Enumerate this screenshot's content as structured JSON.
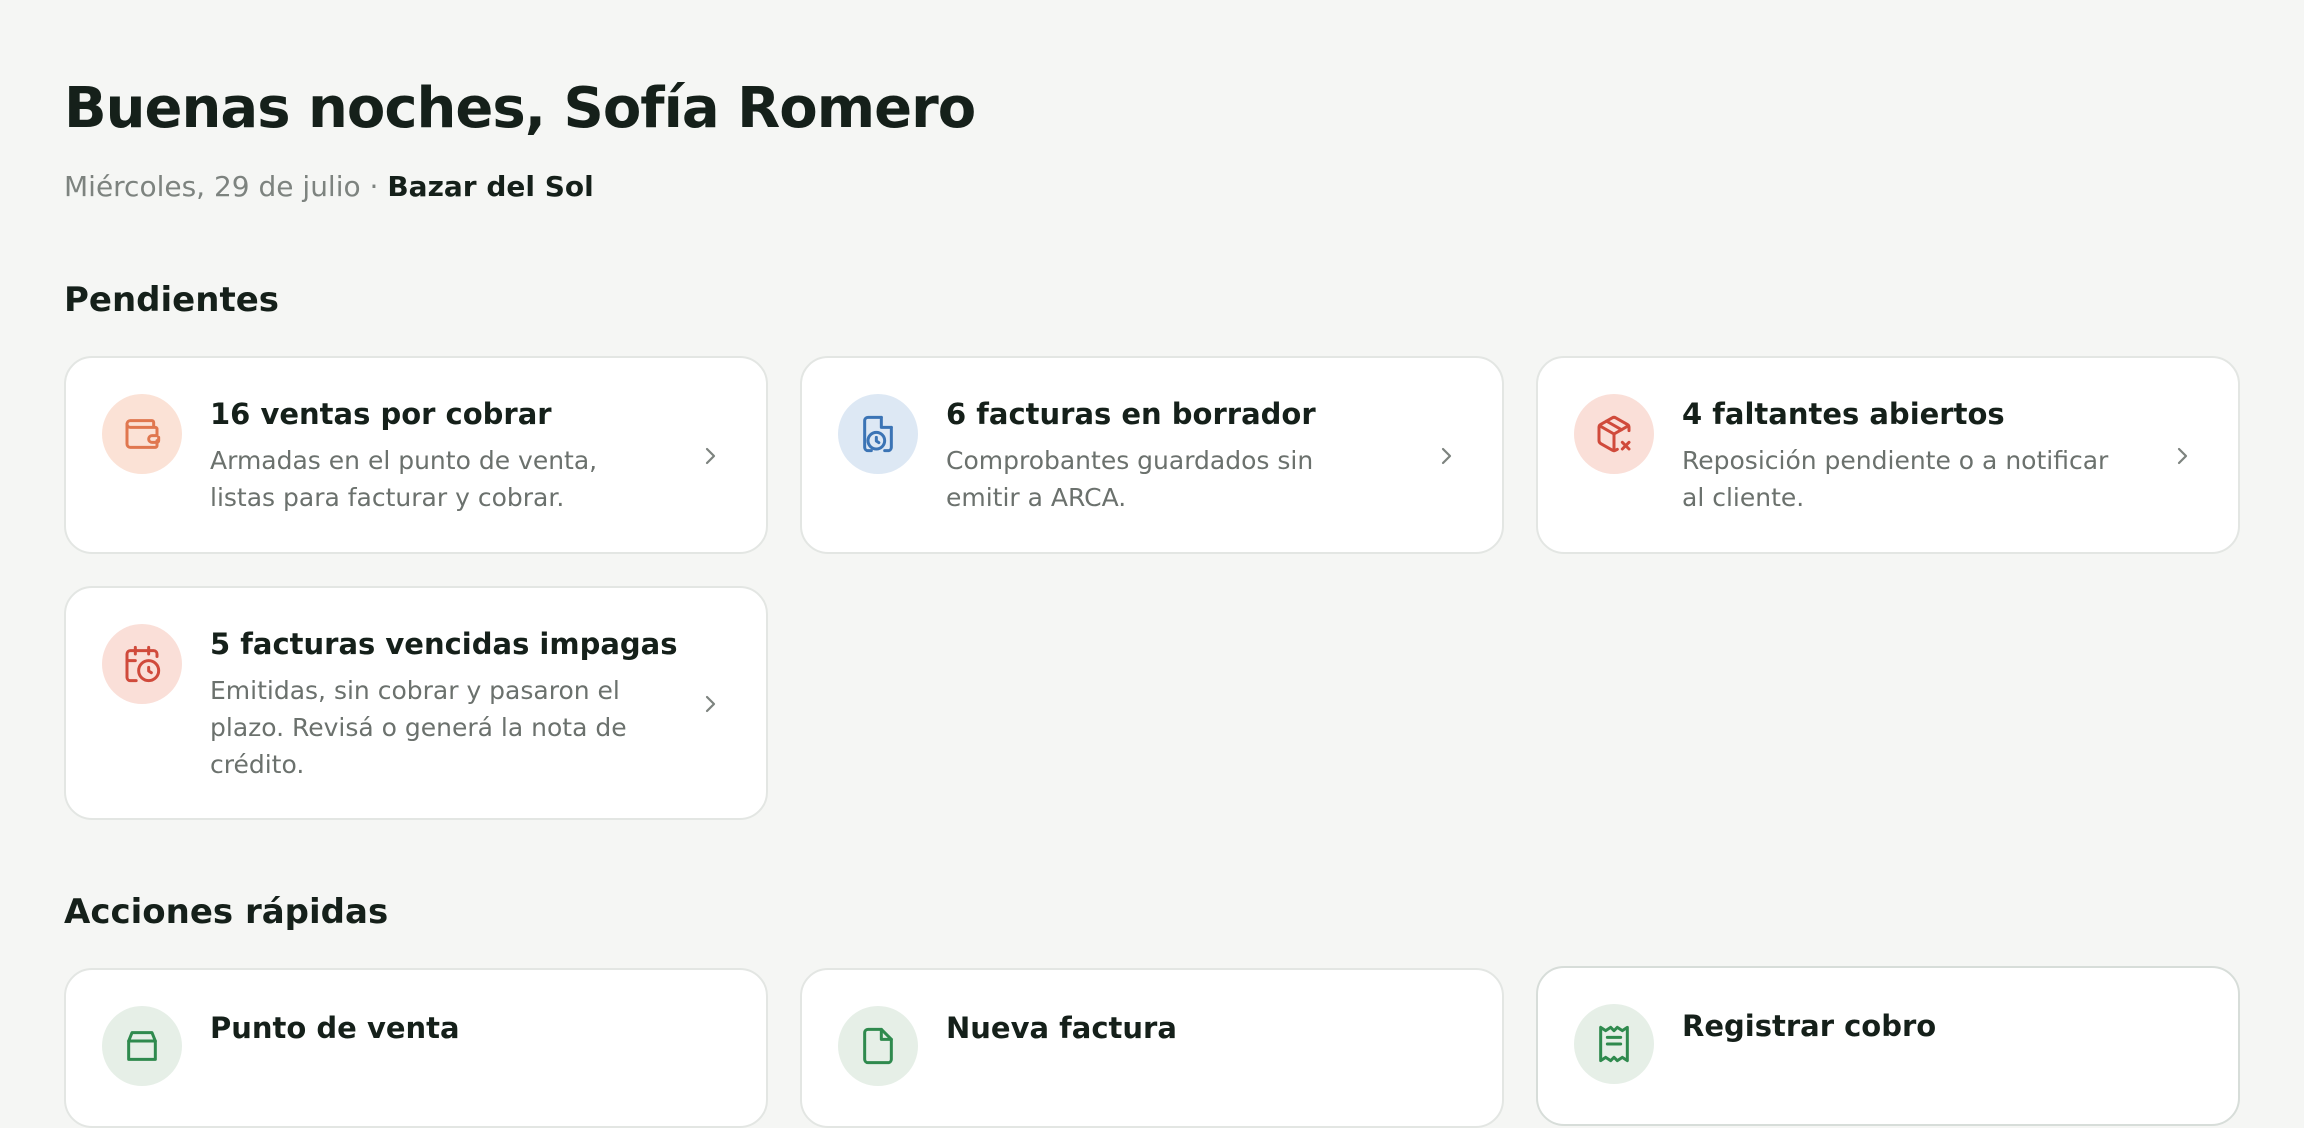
{
  "header": {
    "greeting": "Buenas noches, Sofía Romero",
    "date": "Miércoles, 29 de julio",
    "separator": " · ",
    "store": "Bazar del Sol"
  },
  "pending": {
    "title": "Pendientes",
    "items": [
      {
        "title": "16 ventas por cobrar",
        "description": "Armadas en el punto de venta, listas para facturar y cobrar.",
        "icon": "wallet-icon",
        "color": "#e0774f"
      },
      {
        "title": "6 facturas en borrador",
        "description": "Comprobantes guardados sin emitir a ARCA.",
        "icon": "file-clock-icon",
        "color": "#3b74b5"
      },
      {
        "title": "4 faltantes abiertos",
        "description": "Reposición pendiente o a notificar al cliente.",
        "icon": "package-x-icon",
        "color": "#d04a3b"
      },
      {
        "title": "5 facturas vencidas impagas",
        "description": "Emitidas, sin cobrar y pasaron el plazo. Revisá o generá la nota de crédito.",
        "icon": "calendar-clock-icon",
        "color": "#d04a3b"
      }
    ]
  },
  "quick_actions": {
    "title": "Acciones rápidas",
    "items": [
      {
        "title": "Punto de venta",
        "icon": "store-icon",
        "color": "#2f8a4e"
      },
      {
        "title": "Nueva factura",
        "icon": "file-plus-icon",
        "color": "#2f8a4e"
      },
      {
        "title": "Registrar cobro",
        "icon": "receipt-icon",
        "color": "#2f8a4e"
      }
    ]
  }
}
